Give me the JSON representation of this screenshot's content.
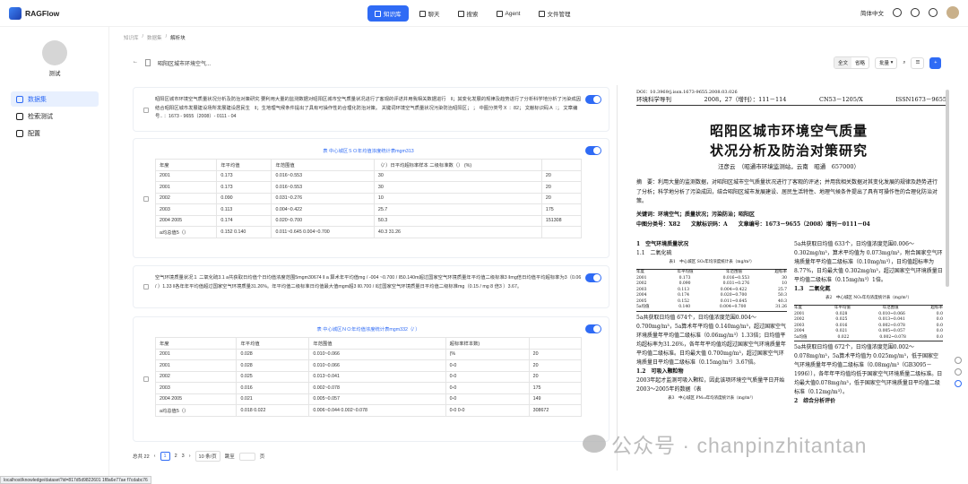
{
  "app": {
    "name": "RAGFlow"
  },
  "nav": [
    {
      "label": "知识库",
      "active": true
    },
    {
      "label": "聊天"
    },
    {
      "label": "搜索"
    },
    {
      "label": "Agent"
    },
    {
      "label": "文件管理"
    }
  ],
  "topright": {
    "lang": "简体中文"
  },
  "sidebar": {
    "kb_name": "测试",
    "items": [
      {
        "label": "数据集",
        "active": true
      },
      {
        "label": "检索测试"
      },
      {
        "label": "配置"
      }
    ]
  },
  "breadcrumb": [
    "知识库",
    "数据集",
    "解析块"
  ],
  "file": {
    "back": "←",
    "name": "昭阳区城市环境空气..."
  },
  "tools": {
    "full": "全文",
    "omit": "省略",
    "batch": "批量"
  },
  "chunks": {
    "c1": "昭阳区城市环境空气质量状况分析及防治对策研究  要利用大量的监测数据对昭阳区城市空气质量状况进行了客观的评述并用我相关数据进行　‖；其变化发展的规律及趋势进行了分析科学地分析了污染成因结合昭阳区城市发展建设场所发展建设居民生　‖；生地理气候条件提出了具有可操作性的合理化防治对策。  关键词环境空气质量状况污染防治昭阳区；  ； 中图分类号Ｘ  ：82；    文献标识码Ａ  ：；    文章编号.. ：1673 - 9655（2008）- 0111 - 04",
    "t1title": "表  中心城区ＳＯ年均值浓度统计表mgm313",
    "t1": [
      [
        "年度",
        "年平均值",
        "年范围值",
        "（/ ）日平均超标率样本 二级标准数（） (%)",
        ""
      ],
      [
        "2001",
        "0.173",
        "0.016~0.553",
        "30",
        "20"
      ],
      [
        "2001",
        "0.173",
        "0.016~0.553",
        "30",
        "20"
      ],
      [
        "2002",
        "0.090",
        "0.031~0.276",
        "10",
        "20"
      ],
      [
        "2003",
        "0.113",
        "0.004~0.422",
        "25.7",
        "175"
      ],
      [
        "2004 2005",
        "0.174",
        "0.020~0.700",
        "50.3",
        "151308"
      ],
      [
        "a均总值5（）",
        "0.152 0.140",
        "0.011~0.645 0.004~0.700",
        "40.3 31.26",
        ""
      ]
    ],
    "c3": "空气环境质量状况１  二氧化硫3.1 a共获取日均值个日均值浓度范围5mgm30674 ‖ a 算术年平均值mg / -004 ~0.700 / ‖50.140m超过国家空气环境质量年平均值二级标准3 ‖mg倍日均值平均超标率为3（0.06 / ）1.33 ‖各年年平均值超过国家空气环境质量31.26%。年平均值二级标准日均值最大值mgm超3 ‖0.700 / ‖过国家空气环境质量日平均值二级标准mg（0.15 / mg 8 倍3 ）3.67。",
    "t2title": "表  中心城区ＮＯ年均值浓度统计表mgm332（/ ）",
    "t2": [
      [
        "年度",
        "年平均值",
        "年范围值",
        "超标率样本数)",
        ""
      ],
      [
        "2001",
        "0.028",
        "0.010~0.066",
        "(%",
        "20"
      ],
      [
        "2001",
        "0.028",
        "0.010~0.066",
        "0-0",
        "20"
      ],
      [
        "2002",
        "0.025",
        "0.013~0.041",
        "0-0",
        "20"
      ],
      [
        "2003",
        "0.016",
        "0.002~0.078",
        "0-0",
        "175"
      ],
      [
        "2004 2005",
        "0.021",
        "0.005~0.057",
        "0-0",
        "149"
      ],
      [
        "a均总值5（）",
        "0.018 0.022",
        "0.006~0.044 0.002~0.078",
        "0-0 0-0",
        "308672"
      ]
    ]
  },
  "pager": {
    "total": "总共 22",
    "pages": [
      "1",
      "2",
      "3"
    ],
    "size": "10 条/页",
    "jump": "跳至",
    "page_unit": "页"
  },
  "pdf": {
    "header_left": "DOI：10.3969/j.issn.1673-9655.2008.03.026",
    "journal": "环境科学导刊",
    "vol": "2008，27（增刊）：111－114",
    "cn": "CN53－1205/X",
    "issn": "ISSN1673－9655",
    "title1": "昭阳区城市环境空气质量",
    "title2": "状况分析及防治对策研究",
    "author": "汪彦云　（昭通市环境监测站，云南　昭通　657000）",
    "abstract": "摘　要：利用大量的监测数据，对昭阳区城市空气质量状况进行了客观的评述；并用我相关数据对其变化发展的规律及趋势进行了分析；科学地分析了污染成因，结合昭阳区城市发展建设、居民生活特性、地理气候条件提出了具有可操作性的合理化防治对策。",
    "keywords": "关键词：环境空气；质量状况；污染防治；昭阳区",
    "classify": "中图分类号：X82　　文献标识码：A　　文章编号：1673－9655（2008）增刊－0111－04",
    "left_col": [
      "1　空气环境质量状况",
      "1.1　二氧化硫",
      "5a共获取日均值 674个，日均值浓度范围0.004～0.700mg/m³，5a算术年平均值 0.140mg/m³，超过国家空气环境质量年平均值二级标准（0.06mg/m³）1.33倍；日均值平均超标率为31.26%，各年年平均值均超过国家空气环境质量年平均值二级标准。日均最大值 0.700mg/m³，超过国家空气环境质量日平均值二级标准（0.15mg/m³）3.67倍。",
      "1.2　可吸入颗粒物",
      "2003年起才监测可吸入颗粒，因此该项环境空气质量平日开始2003～2005年的数据（表"
    ],
    "right_col": [
      "5a共获取日均值 633个，日均值浓度范围0.006～0.302mg/m³，算术平均值为 0.073mg/m³，附合国家空气环境质量年平均值二级标准（0.10mg/m³），日均值超标率为 8.77%，日均最大值 0.302mg/m³，超过国家空气环境质量日平均值二级标准（0.15mg/m³）1倍。",
      "1.3　二氧化氮",
      "5a共获取日均值 672个，日均值浓度范围0.002～0.078mg/m³，5a算术平均值为 0.025mg/m³，低于国家空气环境质量年平均值二级标准（0.08mg/m³（GB3095－1996）），各年年平均值均低于国家空气环境质量二级标准。日均最大值0.078mg/m³，低于国家空气环境质量日平均值二级标准（0.12mg/m³）。",
      "2　综合分析评价"
    ],
    "table1_caption": "表1　中心城区 SO₂年均浓度统计表（mg/m³）",
    "table2_caption": "表2　中心城区 NO₂年均浓度统计表（mg/m³）",
    "table3_caption": "表3　中心城区 PM₁₀年均浓度统计表（mg/m³）"
  },
  "watermark": "公众号 · chanpinzhitantan",
  "status_url": "localhost/knowledge/dataset?id=817d5d9822601 1f8a6e77ae f7cdabc76"
}
